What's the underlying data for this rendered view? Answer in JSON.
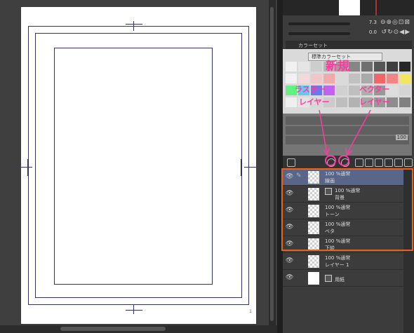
{
  "canvas": {
    "page_marker": "1"
  },
  "navigator": {
    "zoom": "7.3",
    "rotation": "0.0"
  },
  "color_set": {
    "header": "カラーセット",
    "selector_value": "標準カラーセット",
    "swatches": [
      "#ffffff",
      "#f2f2f2",
      "#d9d9d9",
      "#bfbfbf",
      "#a6a6a6",
      "#8c8c8c",
      "#737373",
      "#595959",
      "#404040",
      "#262626",
      "#ffffff",
      "#ffe6e6",
      "#ffd1d1",
      "#ffb3b3",
      "#e6e6e6",
      "#cccccc",
      "#b3b3b3",
      "#ff6b6b",
      "#ff8a8a",
      "#fff266",
      "#66ff88",
      "#6bd4ff",
      "#6b7dff",
      "#cc66ff",
      "#dcdcdc",
      "#c9c9c9",
      "#b8b8b8",
      "#a0a0a0",
      "#eaeaea",
      "#e0e0e0",
      "#fdfdfd",
      "#f0f0f0",
      "#e3e3e3",
      "#d6d6d6",
      "#c8c8c8",
      "#bbbbbb",
      "#aeaeae",
      "#a1a1a1",
      "#949494",
      "#878787"
    ]
  },
  "layer_properties": {
    "opacity": "100"
  },
  "layers": [
    {
      "mode": "100 %通常",
      "name": "線画",
      "active": true,
      "thumb": "transparent",
      "folder": false
    },
    {
      "mode": "100 %通常",
      "name": "背景",
      "active": false,
      "thumb": "transparent",
      "folder": true
    },
    {
      "mode": "100 %通常",
      "name": "トーン",
      "active": false,
      "thumb": "transparent",
      "folder": false
    },
    {
      "mode": "100 %通常",
      "name": "ベタ",
      "active": false,
      "thumb": "transparent",
      "folder": false
    },
    {
      "mode": "100 %通常",
      "name": "下絵",
      "active": false,
      "thumb": "transparent",
      "folder": false
    },
    {
      "mode": "100 %通常",
      "name": "レイヤー 1",
      "active": false,
      "thumb": "transparent",
      "folder": false
    },
    {
      "mode": "",
      "name": "用紙",
      "active": false,
      "thumb": "white",
      "folder": false
    }
  ],
  "annotations": {
    "new": "新規",
    "raster_line1": "ラスター",
    "raster_line2": "レイヤー",
    "vector_line1": "ベクター",
    "vector_line2": "レイヤー"
  },
  "colors": {
    "highlight": "#e8641e",
    "annotation": "#ff3aa0",
    "active_layer": "#5a6688"
  }
}
